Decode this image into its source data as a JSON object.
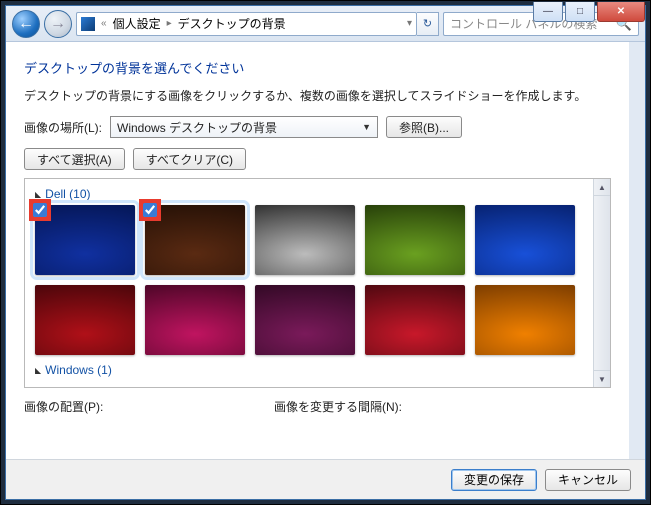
{
  "caption": {
    "minimize_glyph": "—",
    "maximize_glyph": "□",
    "close_glyph": "✕"
  },
  "addressbar": {
    "back_glyph": "←",
    "forward_glyph": "→",
    "prefix_glyph": "«",
    "crumb1": "個人設定",
    "crumb2": "デスクトップの背景",
    "refresh_glyph": "↻",
    "dropdown_glyph": "▾"
  },
  "search": {
    "placeholder": "コントロール パネルの検索",
    "icon_glyph": "🔍"
  },
  "heading": "デスクトップの背景を選んでください",
  "subtext": "デスクトップの背景にする画像をクリックするか、複数の画像を選択してスライドショーを作成します。",
  "location_label": "画像の場所(L):",
  "location_select": {
    "value": "Windows デスクトップの背景"
  },
  "browse_button": "参照(B)...",
  "select_all_button": "すべて選択(A)",
  "clear_all_button": "すべてクリア(C)",
  "groups": [
    {
      "title": "Dell (10)",
      "expanded": true
    },
    {
      "title": "Windows (1)",
      "expanded": true
    }
  ],
  "thumbnails": [
    {
      "name": "dell-blue",
      "selected": true,
      "g1": "#1030a0",
      "g2": "#03124a"
    },
    {
      "name": "dell-brown",
      "selected": true,
      "g1": "#5a2a12",
      "g2": "#1c0c04"
    },
    {
      "name": "dell-silver",
      "selected": false,
      "g1": "#bcbcbc",
      "g2": "#1a1a1a"
    },
    {
      "name": "dell-green",
      "selected": false,
      "g1": "#6aa020",
      "g2": "#1c3006"
    },
    {
      "name": "dell-royal",
      "selected": false,
      "g1": "#1850d8",
      "g2": "#041a60"
    },
    {
      "name": "dell-red",
      "selected": false,
      "g1": "#b01018",
      "g2": "#3a0408"
    },
    {
      "name": "dell-magenta",
      "selected": false,
      "g1": "#c01460",
      "g2": "#3a041e"
    },
    {
      "name": "dell-purple",
      "selected": false,
      "g1": "#7a1a5a",
      "g2": "#26061c"
    },
    {
      "name": "dell-crimson",
      "selected": false,
      "g1": "#c8182a",
      "g2": "#3c060c"
    },
    {
      "name": "dell-orange",
      "selected": false,
      "g1": "#f08000",
      "g2": "#6a3200"
    }
  ],
  "position_label": "画像の配置(P):",
  "interval_label": "画像を変更する間隔(N):",
  "footer": {
    "save": "変更の保存",
    "cancel": "キャンセル"
  }
}
